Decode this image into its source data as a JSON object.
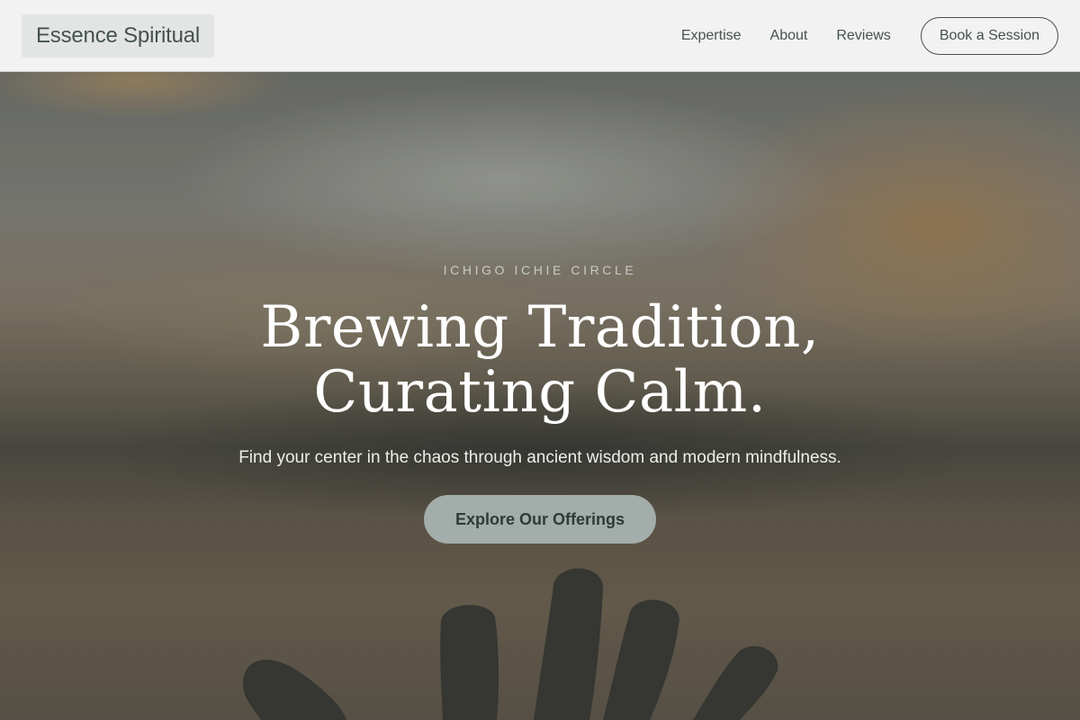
{
  "header": {
    "brand": "Essence Spiritual",
    "nav": {
      "expertise": "Expertise",
      "about": "About",
      "reviews": "Reviews"
    },
    "cta_label": "Book a Session"
  },
  "hero": {
    "eyebrow": "ICHIGO ICHIE CIRCLE",
    "headline_line1": "Brewing Tradition,",
    "headline_line2": "Curating Calm.",
    "subtext": "Find your center in the chaos through ancient wisdom and modern mindfulness.",
    "cta_label": "Explore Our Offerings"
  },
  "colors": {
    "header_bg": "#f1f2f1",
    "brand_text": "#46524f",
    "cta_bg": "#a3ada9",
    "cta_text": "#2f3b38",
    "headline": "#ffffff"
  }
}
